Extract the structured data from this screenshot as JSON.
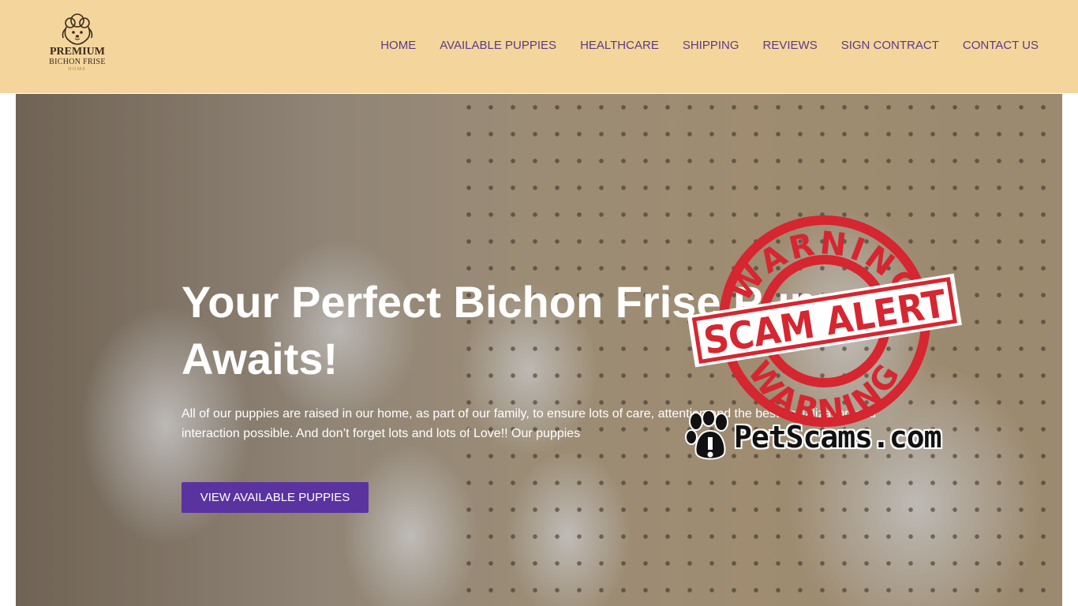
{
  "header": {
    "logo": {
      "line1": "PREMIUM",
      "line2": "BICHON FRISE",
      "line3": "HOME"
    },
    "nav": [
      {
        "label": "HOME"
      },
      {
        "label": "AVAILABLE PUPPIES"
      },
      {
        "label": "HEALTHCARE"
      },
      {
        "label": "SHIPPING"
      },
      {
        "label": "REVIEWS"
      },
      {
        "label": "SIGN CONTRACT"
      },
      {
        "label": "CONTACT US"
      }
    ]
  },
  "hero": {
    "title": "Your Perfect Bichon Frise Puppy Awaits!",
    "text": "All of our puppies are raised in our home, as part of our family, to ensure lots of care, attention and the best socialization and interaction possible. And don’t forget lots and lots of Love!! Our puppies",
    "button_label": "VIEW AVAILABLE PUPPIES"
  },
  "overlay": {
    "stamp_top": "WARNING",
    "stamp_middle": "SCAM ALERT",
    "stamp_bottom": "WARNING",
    "site": "PetScams.com"
  },
  "colors": {
    "header_bg": "#f4d69d",
    "nav_text": "#5a3a86",
    "button_bg": "#5b33a0",
    "stamp_red": "#d62630"
  }
}
